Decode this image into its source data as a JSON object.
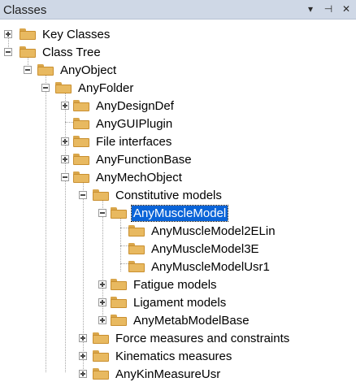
{
  "panel": {
    "title": "Classes",
    "icons": [
      "dropdown-arrow-icon",
      "pin-icon",
      "close-icon"
    ]
  },
  "tree": {
    "items": [
      {
        "label": "Key Classes",
        "expanded": false,
        "selected": false
      },
      {
        "label": "Class Tree",
        "expanded": true,
        "selected": false
      },
      {
        "label": "AnyObject",
        "expanded": true,
        "selected": false
      },
      {
        "label": "AnyFolder",
        "expanded": true,
        "selected": false
      },
      {
        "label": "AnyDesignDef",
        "expanded": false,
        "selected": false
      },
      {
        "label": "AnyGUIPlugin",
        "expanded": null,
        "selected": false
      },
      {
        "label": "File interfaces",
        "expanded": false,
        "selected": false
      },
      {
        "label": "AnyFunctionBase",
        "expanded": false,
        "selected": false
      },
      {
        "label": "AnyMechObject",
        "expanded": true,
        "selected": false
      },
      {
        "label": "Constitutive models",
        "expanded": true,
        "selected": false
      },
      {
        "label": "AnyMuscleModel",
        "expanded": true,
        "selected": true
      },
      {
        "label": "AnyMuscleModel2ELin",
        "expanded": null,
        "selected": false
      },
      {
        "label": "AnyMuscleModel3E",
        "expanded": null,
        "selected": false
      },
      {
        "label": "AnyMuscleModelUsr1",
        "expanded": null,
        "selected": false
      },
      {
        "label": "Fatigue models",
        "expanded": false,
        "selected": false
      },
      {
        "label": "Ligament models",
        "expanded": false,
        "selected": false
      },
      {
        "label": "AnyMetabModelBase",
        "expanded": false,
        "selected": false
      },
      {
        "label": "Force measures and constraints",
        "expanded": false,
        "selected": false
      },
      {
        "label": "Kinematics measures",
        "expanded": false,
        "selected": false
      },
      {
        "label": "AnyKinMeasureUsr",
        "expanded": false,
        "selected": false
      }
    ]
  },
  "colors": {
    "selection": "#0a64d8",
    "folder": "#e8b960",
    "titlebar": "#cfd8e6"
  }
}
